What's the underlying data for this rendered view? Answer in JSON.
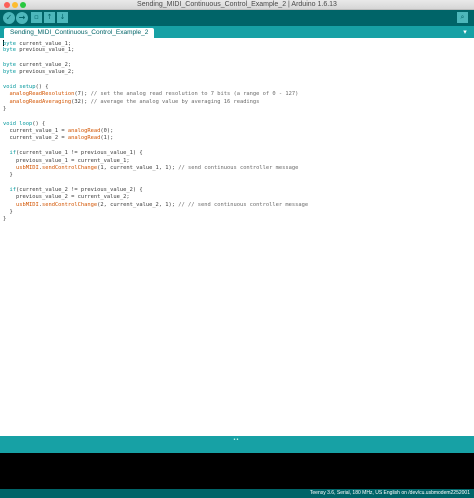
{
  "window": {
    "title": "Sending_MIDI_Continuous_Control_Example_2 | Arduino 1.6.13"
  },
  "toolbar": {
    "buttons": [
      {
        "icon": "verify-check-icon",
        "glyph": "✓"
      },
      {
        "icon": "upload-arrow-icon",
        "glyph": "→"
      },
      {
        "icon": "new-file-icon",
        "glyph": "▫"
      },
      {
        "icon": "open-arrow-up-icon",
        "glyph": "↑"
      },
      {
        "icon": "save-arrow-down-icon",
        "glyph": "↓"
      }
    ],
    "serial_monitor_icon": "magnifier-icon",
    "serial_monitor_glyph": "⌕"
  },
  "tabs": {
    "active_label": "Sending_MIDI_Continuous_Control_Example_2",
    "menu_glyph": "▾"
  },
  "code_lines": [
    [
      {
        "t": "byte",
        "c": "kw"
      },
      {
        "t": " current_value_1;"
      }
    ],
    [
      {
        "t": "byte",
        "c": "kw"
      },
      {
        "t": " previous_value_1;"
      }
    ],
    [],
    [
      {
        "t": "byte",
        "c": "kw"
      },
      {
        "t": " current_value_2;"
      }
    ],
    [
      {
        "t": "byte",
        "c": "kw"
      },
      {
        "t": " previous_value_2;"
      }
    ],
    [],
    [
      {
        "t": "void",
        "c": "kw"
      },
      {
        "t": " "
      },
      {
        "t": "setup",
        "c": "kw"
      },
      {
        "t": "() {"
      }
    ],
    [
      {
        "t": "  "
      },
      {
        "t": "analogReadResolution",
        "c": "fn"
      },
      {
        "t": "(7); "
      },
      {
        "t": "// set the analog read resolution to 7 bits (a range of 0 - 127)",
        "c": "cm"
      }
    ],
    [
      {
        "t": "  "
      },
      {
        "t": "analogReadAveraging",
        "c": "fn"
      },
      {
        "t": "(32); "
      },
      {
        "t": "// average the analog value by averaging 16 readings",
        "c": "cm"
      }
    ],
    [
      {
        "t": "}"
      }
    ],
    [],
    [
      {
        "t": "void",
        "c": "kw"
      },
      {
        "t": " "
      },
      {
        "t": "loop",
        "c": "kw"
      },
      {
        "t": "() {"
      }
    ],
    [
      {
        "t": "  current_value_1 = "
      },
      {
        "t": "analogRead",
        "c": "fn"
      },
      {
        "t": "(0);"
      }
    ],
    [
      {
        "t": "  current_value_2 = "
      },
      {
        "t": "analogRead",
        "c": "fn"
      },
      {
        "t": "(1);"
      }
    ],
    [],
    [
      {
        "t": "  "
      },
      {
        "t": "if",
        "c": "kw"
      },
      {
        "t": "(current_value_1 != previous_value_1) {"
      }
    ],
    [
      {
        "t": "    previous_value_1 = current_value_1;"
      }
    ],
    [
      {
        "t": "    "
      },
      {
        "t": "usbMIDI",
        "c": "fn"
      },
      {
        "t": "."
      },
      {
        "t": "sendControlChange",
        "c": "fn"
      },
      {
        "t": "(1, current_value_1, 1); "
      },
      {
        "t": "// send continuous controller message",
        "c": "cm"
      }
    ],
    [
      {
        "t": "  }"
      }
    ],
    [],
    [
      {
        "t": "  "
      },
      {
        "t": "if",
        "c": "kw"
      },
      {
        "t": "(current_value_2 != previous_value_2) {"
      }
    ],
    [
      {
        "t": "    previous_value_2 = current_value_2;"
      }
    ],
    [
      {
        "t": "    "
      },
      {
        "t": "usbMIDI",
        "c": "fn"
      },
      {
        "t": "."
      },
      {
        "t": "sendControlChange",
        "c": "fn"
      },
      {
        "t": "(2, current_value_2, 1); "
      },
      {
        "t": "// // send continuous controller message",
        "c": "cm"
      }
    ],
    [
      {
        "t": "  }"
      }
    ],
    [
      {
        "t": "}"
      }
    ]
  ],
  "status": {
    "board_info": "Teensy 3.6, Serial, 180 MHz, US English on /dev/cu.usbmodem2252001"
  },
  "colors": {
    "toolbar": "#006468",
    "tabbar": "#17a1a5",
    "button": "#4db7bb",
    "keyword": "#00979c",
    "function": "#d35400"
  }
}
